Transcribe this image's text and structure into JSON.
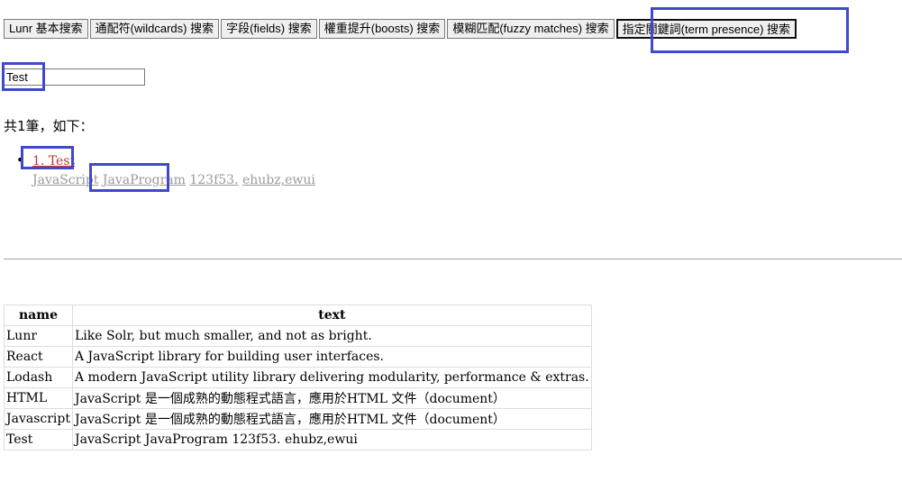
{
  "tabs": [
    {
      "label": "Lunr 基本搜索"
    },
    {
      "label": "通配符(wildcards) 搜索"
    },
    {
      "label": "字段(fields) 搜索"
    },
    {
      "label": "權重提升(boosts) 搜索"
    },
    {
      "label": "模糊匹配(fuzzy matches) 搜索"
    },
    {
      "label": "指定關鍵詞(term presence) 搜索"
    }
  ],
  "search": {
    "value": "Test",
    "placeholder": ""
  },
  "results": {
    "count_text": "共1筆，如下：",
    "items": [
      {
        "title": "1. Test",
        "text_parts": [
          "JavaScript",
          "JavaProgram",
          "123f53.",
          "ehubz,ewui"
        ]
      }
    ]
  },
  "table": {
    "headers": [
      "name",
      "text"
    ],
    "rows": [
      [
        "Lunr",
        "Like Solr, but much smaller, and not as bright."
      ],
      [
        "React",
        "A JavaScript library for building user interfaces."
      ],
      [
        "Lodash",
        "A modern JavaScript utility library delivering modularity, performance & extras."
      ],
      [
        "HTML",
        "JavaScript 是一個成熟的動態程式語言，應用於HTML 文件（document）"
      ],
      [
        "Javascript",
        "JavaScript 是一個成熟的動態程式語言，應用於HTML 文件（document）"
      ],
      [
        "Test",
        "JavaScript JavaProgram 123f53. ehubz,ewui"
      ]
    ]
  },
  "colors": {
    "highlight": "#3f49c9",
    "result_title": "#c0392b",
    "result_text": "#999999"
  }
}
